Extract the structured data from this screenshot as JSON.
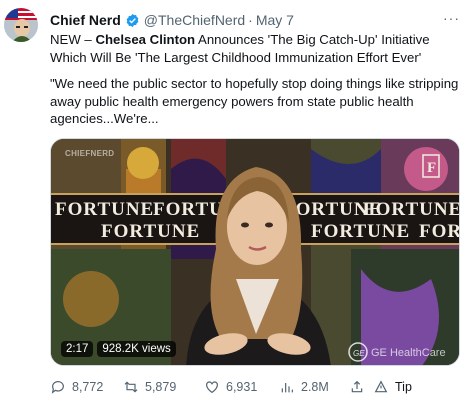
{
  "tweet": {
    "author_name": "Chief Nerd",
    "handle": "@TheChiefNerd",
    "separator": "·",
    "date": "May 7",
    "more_label": "···",
    "line1_prefix": "NEW – ",
    "line1_bold": "Chelsea Clinton",
    "line1_rest": " Announces 'The Big Catch-Up' Initiative Which Will Be 'The Largest Childhood Immunization Effort Ever'",
    "quote": "\"We need the public sector to hopefully stop doing things like stripping away public health emergency powers from state public health agencies...We're..."
  },
  "video": {
    "duration": "2:17",
    "views": "928.2K views",
    "channel_watermark": "CHIEFNERD",
    "banner_word": "FORTUNE",
    "logo_letter": "F",
    "sponsor_text": "GE HealthCare"
  },
  "actions": {
    "replies": "8,772",
    "retweets": "5,879",
    "likes": "6,931",
    "views": "2.8M",
    "tip": "Tip"
  },
  "colors": {
    "verified": "#1d9bf0",
    "text": "#0f1419",
    "secondary": "#536471"
  }
}
